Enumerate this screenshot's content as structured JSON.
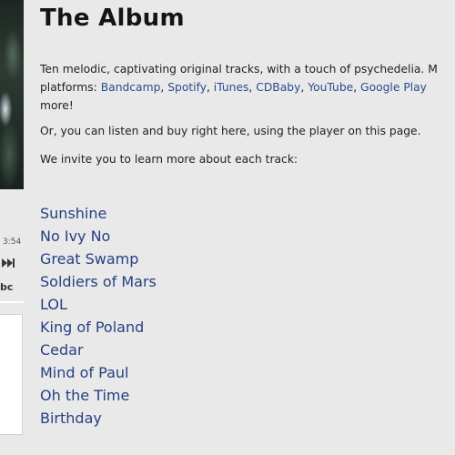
{
  "player": {
    "time": "3:54",
    "skip_icon": "skip-forward-icon",
    "bc_label": "bc"
  },
  "page": {
    "title": "The Album",
    "intro_text": "Ten melodic, captivating original tracks, with a touch of psychedelia.  M",
    "platforms_prefix": "platforms: ",
    "platforms": [
      "Bandcamp",
      "Spotify",
      "iTunes",
      "CDBaby",
      "YouTube",
      "Google Play"
    ],
    "intro_end": "more!",
    "listen_text": "Or, you can listen and buy right here, using the player on this page.",
    "invite_text": "We invite you to learn more about each track:"
  },
  "tracks": [
    "Sunshine",
    "No Ivy No",
    "Great Swamp",
    "Soldiers of Mars",
    "LOL",
    "King of Poland",
    "Cedar",
    "Mind of Paul",
    "Oh the Time",
    "Birthday"
  ],
  "colors": {
    "background": "#e9e9e9",
    "link": "#253f82",
    "text": "#1f1f1f"
  }
}
